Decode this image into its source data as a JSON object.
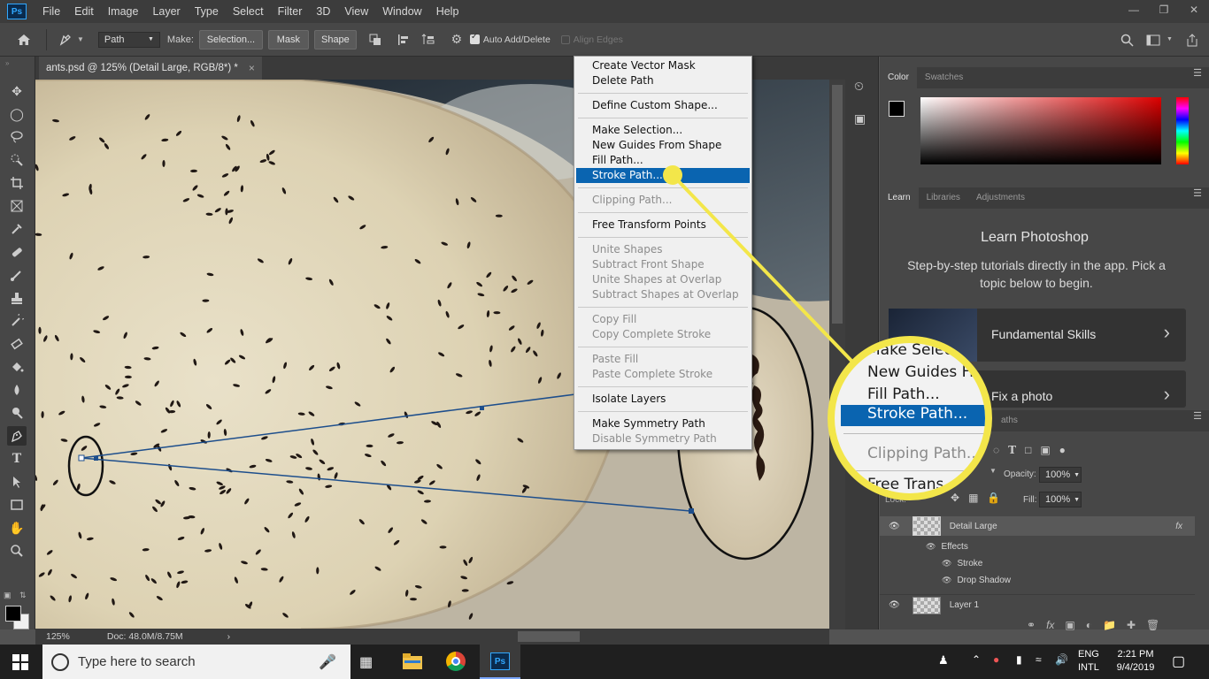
{
  "app": {
    "logo": "Ps",
    "menus": [
      "File",
      "Edit",
      "Image",
      "Layer",
      "Type",
      "Select",
      "Filter",
      "3D",
      "View",
      "Window",
      "Help"
    ]
  },
  "options_bar": {
    "mode_value": "Path",
    "make_label": "Make:",
    "selection_button": "Selection...",
    "mask_button": "Mask",
    "shape_button": "Shape",
    "auto_add_delete": "Auto Add/Delete",
    "align_edges": "Align Edges"
  },
  "document": {
    "tab_title": "ants.psd @ 125% (Detail Large, RGB/8*) *",
    "close_glyph": "×",
    "zoom": "125%",
    "doc_size": "Doc: 48.0M/8.75M"
  },
  "context_menu": {
    "items": [
      {
        "label": "Create Vector Mask",
        "enabled": true
      },
      {
        "label": "Delete Path",
        "enabled": true
      },
      {
        "label": "Define Custom Shape...",
        "enabled": true
      },
      {
        "label": "Make Selection...",
        "enabled": true
      },
      {
        "label": "New Guides From Shape",
        "enabled": true
      },
      {
        "label": "Fill Path...",
        "enabled": true
      },
      {
        "label": "Stroke Path...",
        "enabled": true,
        "highlighted": true
      },
      {
        "label": "Clipping Path...",
        "enabled": false
      },
      {
        "label": "Free Transform Points",
        "enabled": true
      },
      {
        "label": "Unite Shapes",
        "enabled": false
      },
      {
        "label": "Subtract Front Shape",
        "enabled": false
      },
      {
        "label": "Unite Shapes at Overlap",
        "enabled": false
      },
      {
        "label": "Subtract Shapes at Overlap",
        "enabled": false
      },
      {
        "label": "Copy Fill",
        "enabled": false
      },
      {
        "label": "Copy Complete Stroke",
        "enabled": false
      },
      {
        "label": "Paste Fill",
        "enabled": false
      },
      {
        "label": "Paste Complete Stroke",
        "enabled": false
      },
      {
        "label": "Isolate Layers",
        "enabled": true
      },
      {
        "label": "Make Symmetry Path",
        "enabled": true
      },
      {
        "label": "Disable Symmetry Path",
        "enabled": false
      }
    ]
  },
  "callout": {
    "lines": [
      "Make Selec",
      "New Guides Fr",
      "Fill Path...",
      "Stroke Path...",
      "Clipping Path...",
      "Free Trans"
    ],
    "color": "#f3e64a"
  },
  "color_panel": {
    "tabs": [
      "Color",
      "Swatches"
    ]
  },
  "learn_panel": {
    "tabs": [
      "Learn",
      "Libraries",
      "Adjustments"
    ],
    "title": "Learn Photoshop",
    "subtitle": "Step-by-step tutorials directly in the app. Pick a topic below to begin.",
    "cards": [
      "Fundamental Skills",
      "Fix a photo"
    ],
    "chevron": "›"
  },
  "layers_panel": {
    "tab_fragment": "aths",
    "opacity_label": "Opacity:",
    "opacity_value": "100%",
    "lock_label": "Lock:",
    "fill_label": "Fill:",
    "fill_value": "100%",
    "layers": [
      {
        "name": "Detail Large",
        "fx": "fx"
      },
      {
        "name": "Effects"
      },
      {
        "name": "Stroke"
      },
      {
        "name": "Drop Shadow"
      },
      {
        "name": "Layer 1"
      }
    ]
  },
  "taskbar": {
    "search_placeholder": "Type here to search",
    "lang_top": "ENG",
    "lang_bottom": "INTL",
    "time": "2:21 PM",
    "date": "9/4/2019",
    "ps_label": "Ps"
  },
  "colors": {
    "accent_blue": "#0a64b0",
    "highlight_yellow": "#f3e64a"
  }
}
